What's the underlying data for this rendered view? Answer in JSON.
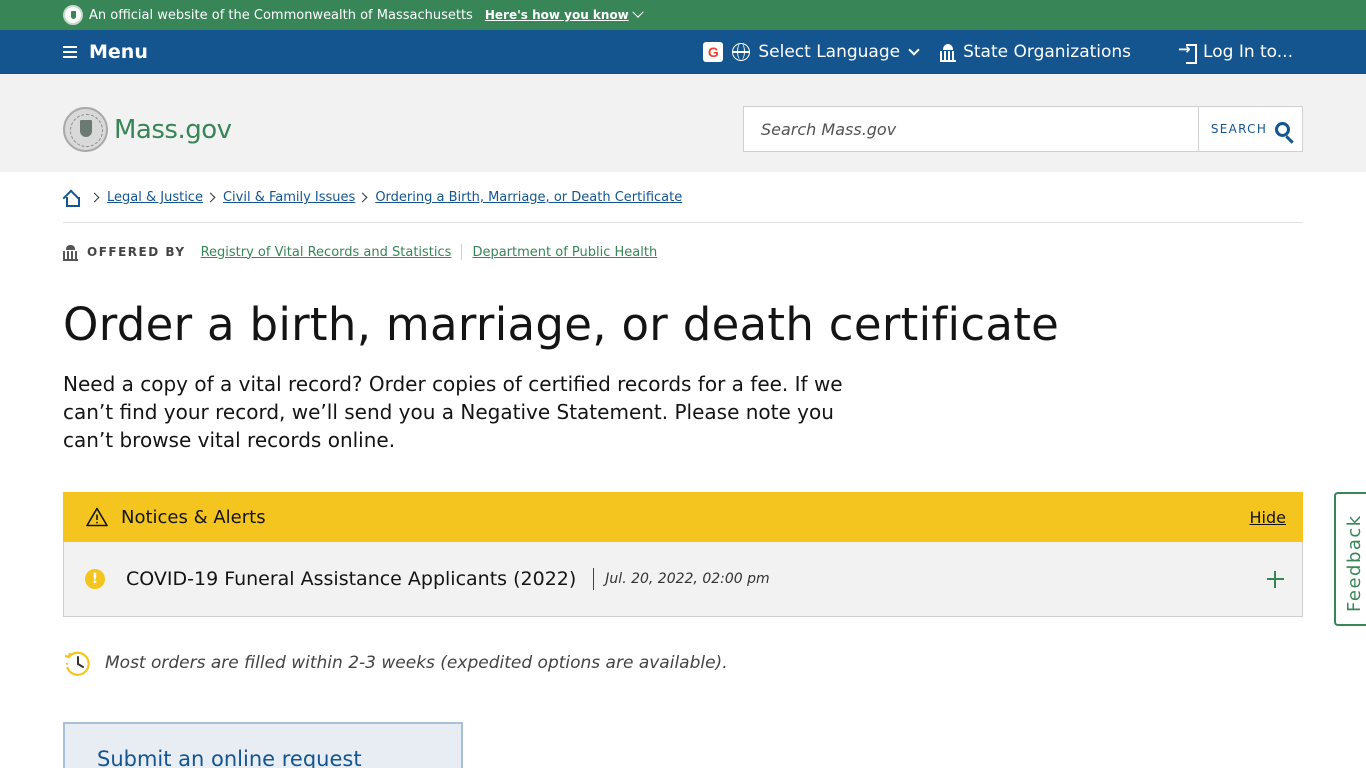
{
  "official_banner": {
    "text": "An official website of the Commonwealth of Massachusetts",
    "link": "Here's how you know"
  },
  "utility_nav": {
    "menu_label": "Menu",
    "language_label": "Select Language",
    "state_orgs_label": "State Organizations",
    "login_label": "Log In to..."
  },
  "header": {
    "logo_text": "Mass.gov",
    "search_placeholder": "Search Mass.gov",
    "search_button": "SEARCH"
  },
  "breadcrumb": {
    "items": [
      "Legal & Justice",
      "Civil & Family Issues",
      "Ordering a Birth, Marriage, or Death Certificate"
    ]
  },
  "offered_by": {
    "label": "OFFERED BY",
    "orgs": [
      "Registry of Vital Records and Statistics",
      "Department of Public Health"
    ]
  },
  "page": {
    "title": "Order a birth, marriage, or death certificate",
    "lede": "Need a copy of a vital record? Order copies of certified records for a fee. If we can’t find your record, we’ll send you a Negative Statement. Please note you can’t browse vital records online."
  },
  "alerts": {
    "title": "Notices & Alerts",
    "hide_label": "Hide",
    "items": [
      {
        "title": "COVID-19 Funeral Assistance Applicants (2022)",
        "date": "Jul. 20, 2022, 02:00 pm"
      }
    ]
  },
  "timing_note": "Most orders are filled within 2-3 weeks (expedited options are available).",
  "cta": {
    "label": "Submit an online request"
  },
  "feedback_label": "Feedback",
  "colors": {
    "official_green": "#388557",
    "nav_blue": "#14558f",
    "alert_yellow": "#f4c51e",
    "header_gray": "#f2f2f2"
  }
}
